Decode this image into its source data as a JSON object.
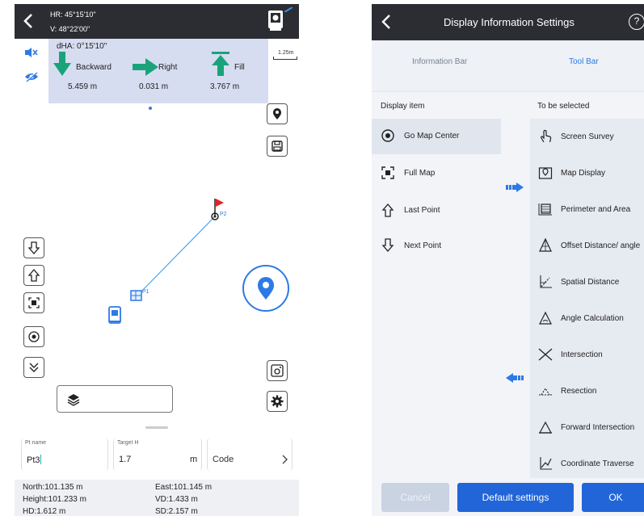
{
  "left_screen": {
    "hr": "HR: 45°15'10\"",
    "v": "V: 48°22'00\"",
    "dha": "dHA: 0°15'10\"",
    "scale": "1.25m",
    "backward": {
      "label": "Backward",
      "value": "5.459 m"
    },
    "right": {
      "label": "Right",
      "value": "0.031 m"
    },
    "fill": {
      "label": "Fill",
      "value": "3.767 m"
    },
    "points": {
      "p2": "P2",
      "p1": "P1"
    },
    "fields": {
      "pt_name_label": "Pt name",
      "pt_name_value": "Pt3",
      "target_h_label": "Target H",
      "target_h_value": "1.7",
      "unit": "m",
      "code_placeholder": "Code"
    },
    "info": {
      "north": "North:101.135 m",
      "east": "East:101.145 m",
      "height": "Height:101.233 m",
      "vd": "VD:1.433 m",
      "hd": "HD:1.612 m",
      "sd": "SD:2.157 m"
    },
    "colors": {
      "accent": "#2d7ae6",
      "green": "#1aa37a",
      "flag": "#e02424"
    }
  },
  "right_screen": {
    "title": "Display Information Settings",
    "help": "?",
    "tabs": [
      {
        "label": "Information Bar",
        "active": false
      },
      {
        "label": "Tool Bar",
        "active": true
      }
    ],
    "display_header": "Display item",
    "selected_header": "To be selected",
    "display_items": [
      {
        "label": "Go Map Center",
        "icon": "target-icon",
        "selected": true
      },
      {
        "label": "Full Map",
        "icon": "full-map-icon",
        "selected": false
      },
      {
        "label": "Last Point",
        "icon": "arrow-up-icon",
        "selected": false
      },
      {
        "label": "Next Point",
        "icon": "arrow-down-icon",
        "selected": false
      }
    ],
    "to_be_selected": [
      {
        "label": "Screen Survey",
        "icon": "hand-tap-icon"
      },
      {
        "label": "Map Display",
        "icon": "map-icon"
      },
      {
        "label": "Perimeter and Area",
        "icon": "area-icon"
      },
      {
        "label": "Offset Distance/ angle",
        "icon": "offset-icon"
      },
      {
        "label": "Spatial Distance",
        "icon": "spatial-icon"
      },
      {
        "label": "Angle Calculation",
        "icon": "angle-icon"
      },
      {
        "label": "Intersection",
        "icon": "intersection-icon"
      },
      {
        "label": "Resection",
        "icon": "resection-icon"
      },
      {
        "label": "Forward Intersection",
        "icon": "forward-intersection-icon"
      },
      {
        "label": "Coordinate Traverse",
        "icon": "traverse-icon"
      }
    ],
    "buttons": {
      "cancel": "Cancel",
      "default": "Default settings",
      "ok": "OK"
    }
  }
}
